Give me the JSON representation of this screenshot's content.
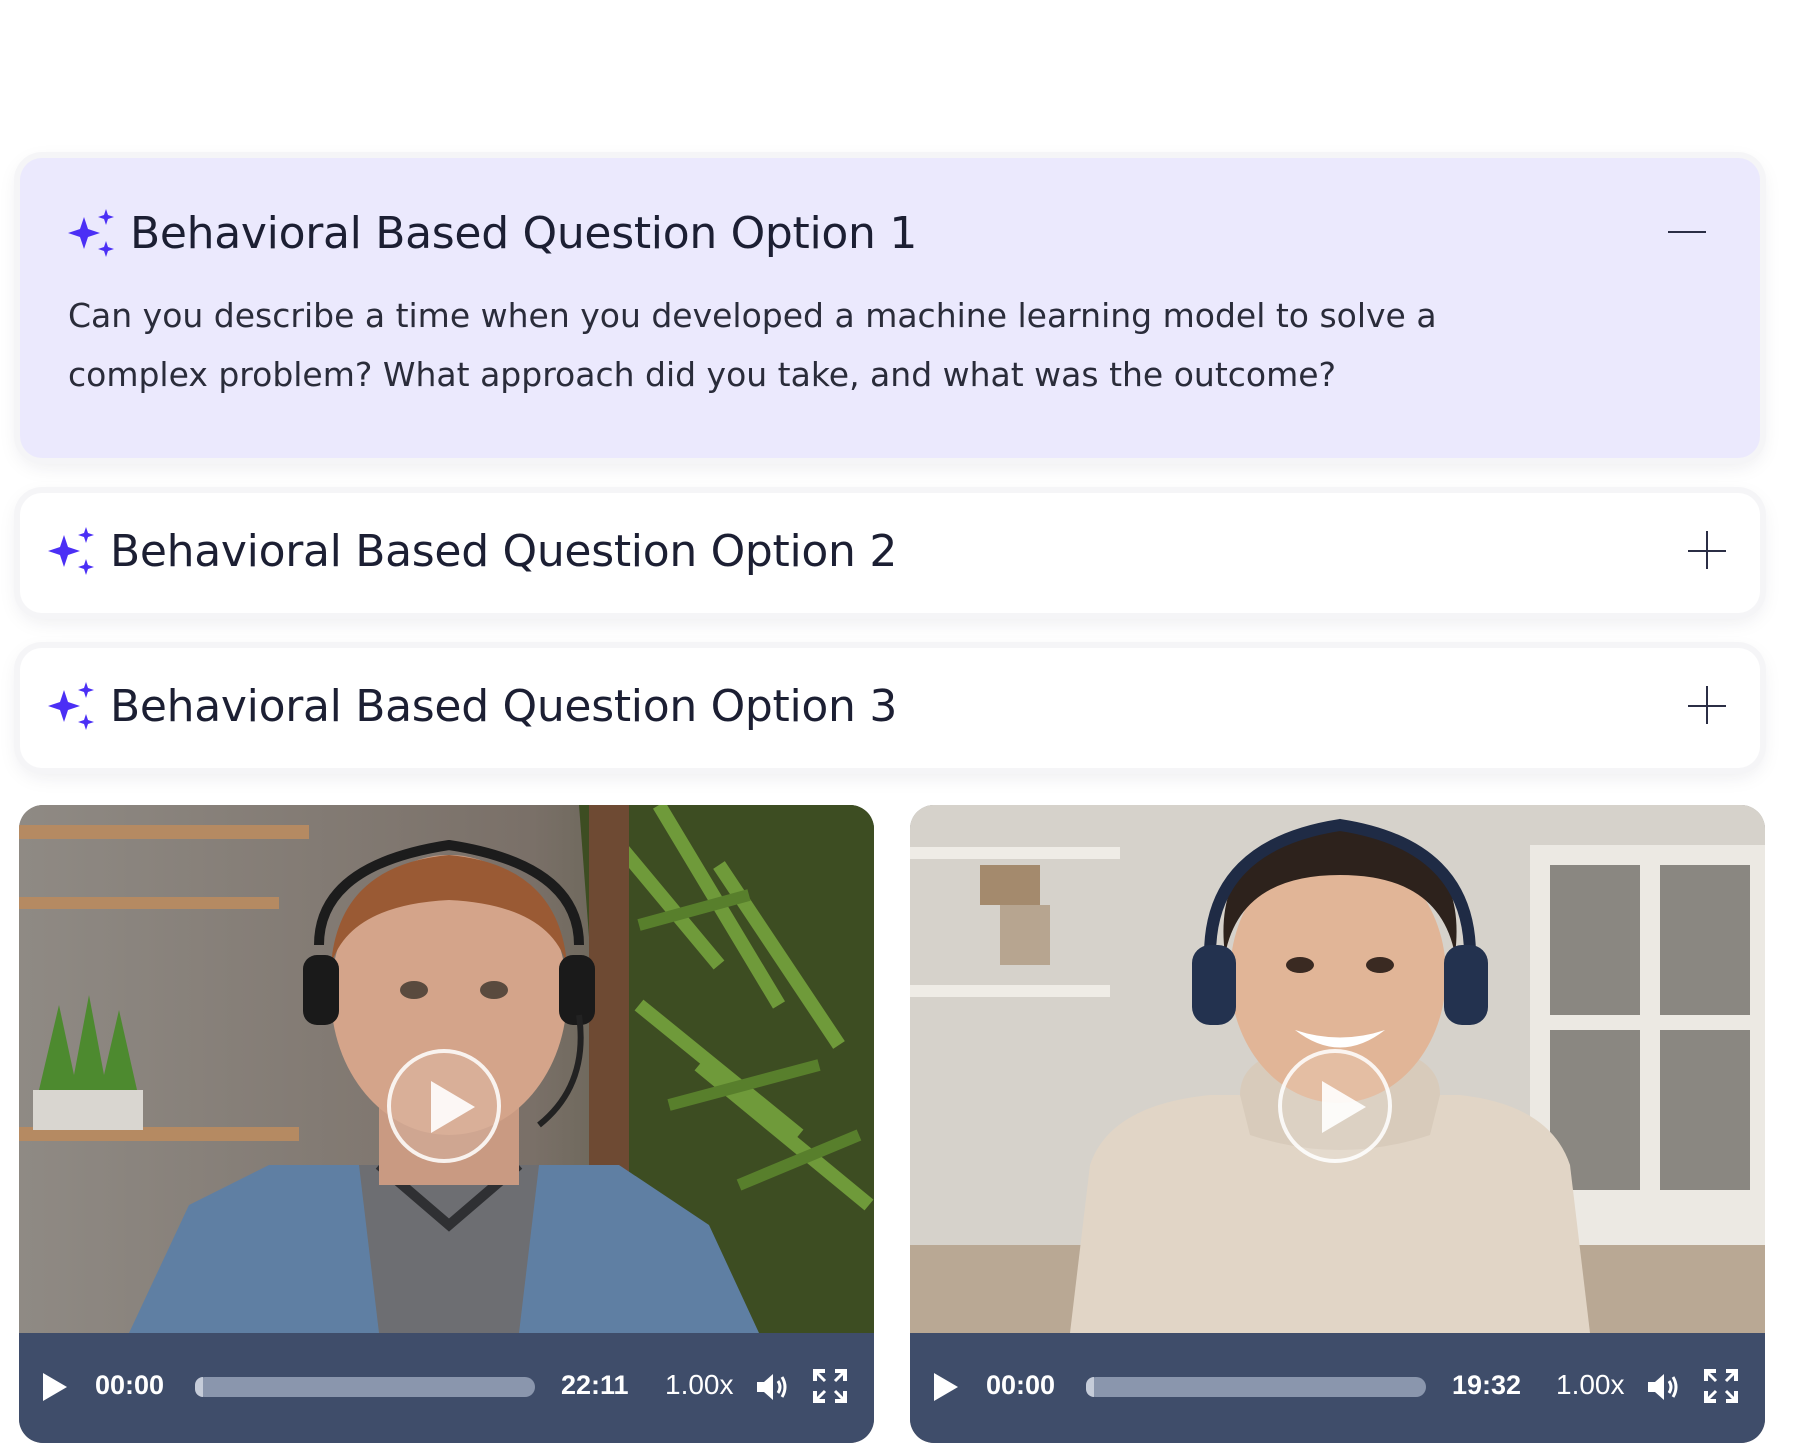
{
  "questions": [
    {
      "title": "Behavioral Based Question Option 1",
      "expanded": true,
      "toggle_icon": "minus-icon",
      "body": "Can you describe a time when you developed a machine learning model to solve a complex problem? What approach did you take, and what was the outcome?"
    },
    {
      "title": "Behavioral Based Question Option 2",
      "expanded": false,
      "toggle_icon": "plus-icon"
    },
    {
      "title": "Behavioral Based Question Option 3",
      "expanded": false,
      "toggle_icon": "plus-icon"
    }
  ],
  "videos": [
    {
      "current_time": "00:00",
      "duration": "22:11",
      "speed": "1.00x",
      "progress": 0
    },
    {
      "current_time": "00:00",
      "duration": "19:32",
      "speed": "1.00x",
      "progress": 0
    }
  ],
  "colors": {
    "accent": "#4b2ff5",
    "expanded_bg": "#ebe9fd",
    "controls_bg": "#3f4d6a",
    "title_text": "#1c1f33"
  }
}
